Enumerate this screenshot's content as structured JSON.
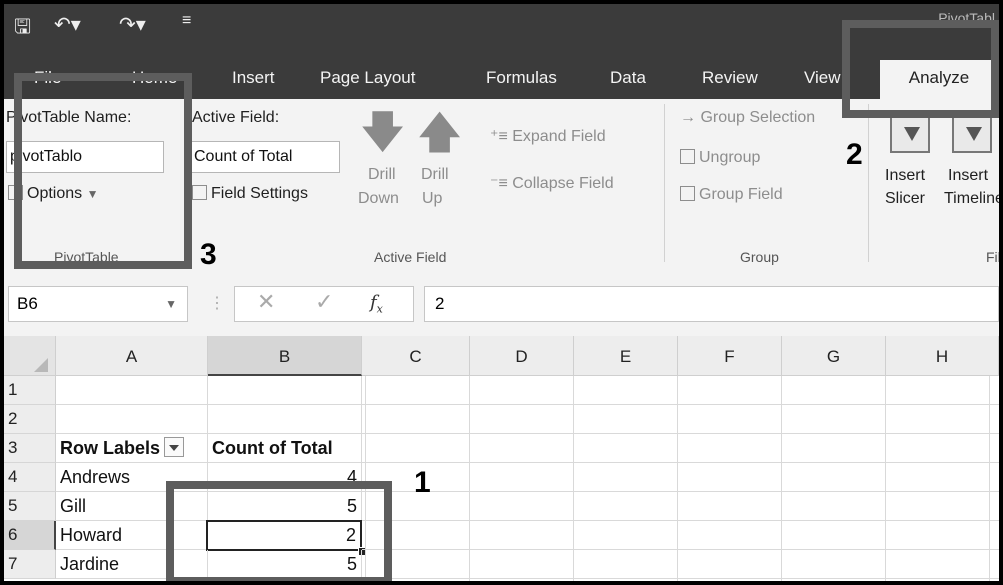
{
  "window": {
    "title": "PivotTabl"
  },
  "menu_tabs": [
    "File",
    "Home",
    "Insert",
    "Page Layout",
    "Formulas",
    "Data",
    "Review",
    "View",
    "Analyze"
  ],
  "ribbon": {
    "pivottable": {
      "name_label": "PivotTable Name:",
      "name_value": "pivotTablo",
      "options_label": "Options",
      "group_label": "PivotTable"
    },
    "active_field": {
      "label": "Active Field:",
      "value": "Count of Total",
      "field_settings": "Field Settings",
      "drill_down": [
        "Drill",
        "Down"
      ],
      "drill_up": [
        "Drill",
        "Up"
      ],
      "expand_field": "Expand Field",
      "collapse_field": "Collapse Field",
      "group_label": "Active Field"
    },
    "group": {
      "group_selection": "Group Selection",
      "ungroup": "Ungroup",
      "group_field": "Group Field",
      "group_label": "Group"
    },
    "filter": {
      "insert_slicer": [
        "Insert",
        "Slicer"
      ],
      "insert_timeline": [
        "Insert",
        "Timeline"
      ],
      "group_label": "Filter"
    }
  },
  "formula_bar": {
    "name_box": "B6",
    "formula": "2"
  },
  "grid": {
    "columns": [
      "A",
      "B",
      "C",
      "D",
      "E",
      "F",
      "G",
      "H"
    ],
    "rows": [
      {
        "num": "1",
        "a": "",
        "b": ""
      },
      {
        "num": "2",
        "a": "",
        "b": ""
      },
      {
        "num": "3",
        "a": "Row Labels",
        "b": "Count of Total"
      },
      {
        "num": "4",
        "a": "Andrews",
        "b": "4"
      },
      {
        "num": "5",
        "a": "Gill",
        "b": "5"
      },
      {
        "num": "6",
        "a": "Howard",
        "b": "2"
      },
      {
        "num": "7",
        "a": "Jardine",
        "b": "5"
      }
    ]
  },
  "callouts": {
    "one": "1",
    "two": "2",
    "three": "3"
  },
  "colors": {
    "chrome_dark": "#3b3b3b",
    "ribbon_bg": "#f3f3f3",
    "highlight_box": "#5d5d5d"
  }
}
